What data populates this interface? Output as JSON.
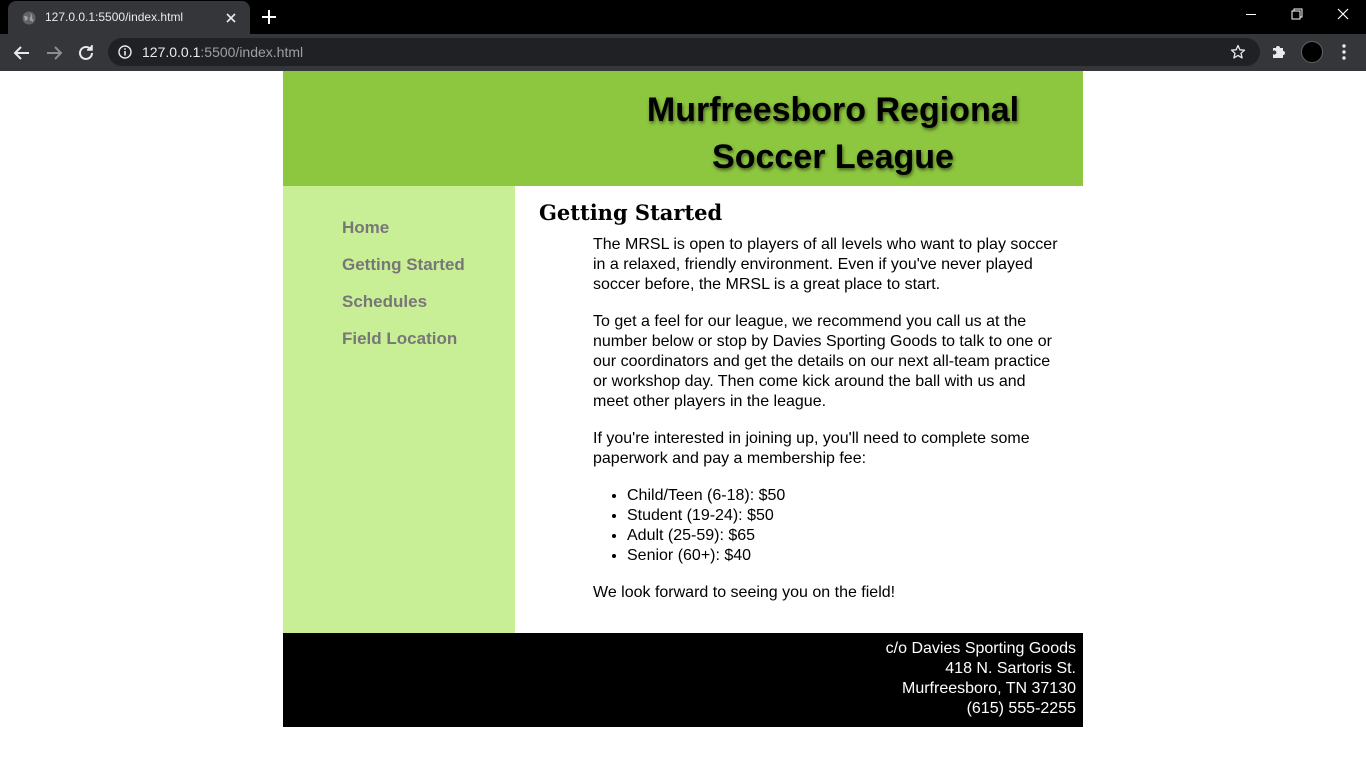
{
  "browser": {
    "tab_title": "127.0.0.1:5500/index.html",
    "url_host": "127.0.0.1",
    "url_rest": ":5500/index.html"
  },
  "site": {
    "title": "Murfreesboro Regional Soccer League",
    "colors": {
      "header": "#8dc63f",
      "sidebar": "#c9ef96",
      "footer": "#000000"
    }
  },
  "nav": {
    "items": [
      {
        "label": "Home"
      },
      {
        "label": "Getting Started"
      },
      {
        "label": "Schedules"
      },
      {
        "label": "Field Location"
      }
    ]
  },
  "main": {
    "heading": "Getting Started",
    "para1": "The MRSL is open to players of all levels who want to play soccer in a relaxed, friendly environment. Even if you've never played soccer before, the MRSL is a great place to start.",
    "para2": "To get a feel for our league, we recommend you call us at the number below or stop by Davies Sporting Goods to talk to one or our coordinators and get the details on our next all-team practice or workshop day. Then come kick around the ball with us and meet other players in the league.",
    "para3": "If you're interested in joining up, you'll need to complete some paperwork and pay a membership fee:",
    "fees": [
      {
        "text": "Child/Teen (6-18): $50"
      },
      {
        "text": "Student (19-24): $50"
      },
      {
        "text": "Adult (25-59): $65"
      },
      {
        "text": "Senior (60+): $40"
      }
    ],
    "closing": "We look forward to seeing you on the field!"
  },
  "footer": {
    "line1": "c/o Davies Sporting Goods",
    "line2": "418 N. Sartoris St.",
    "line3": "Murfreesboro, TN 37130",
    "line4": "(615) 555-2255"
  }
}
